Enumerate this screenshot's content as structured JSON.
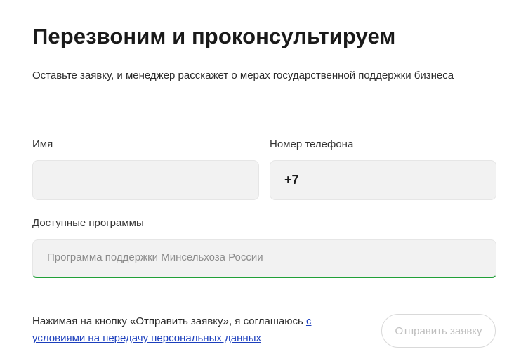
{
  "form": {
    "title": "Перезвоним и проконсультируем",
    "subtitle": "Оставьте заявку, и менеджер расскажет о мерах государственной поддержки бизнеса",
    "name_field": {
      "label": "Имя",
      "value": ""
    },
    "phone_field": {
      "label": "Номер телефона",
      "value": "+7"
    },
    "programs_field": {
      "label": "Доступные программы",
      "selected": "Программа поддержки Минсельхоза России",
      "accent_color": "#21a038"
    },
    "consent": {
      "text_before_link": "Нажимая на кнопку «Отправить заявку», я соглашаюсь ",
      "link_text": "с условиями на передачу персональных данных"
    },
    "submit_label": "Отправить заявку",
    "submit_disabled": true
  }
}
